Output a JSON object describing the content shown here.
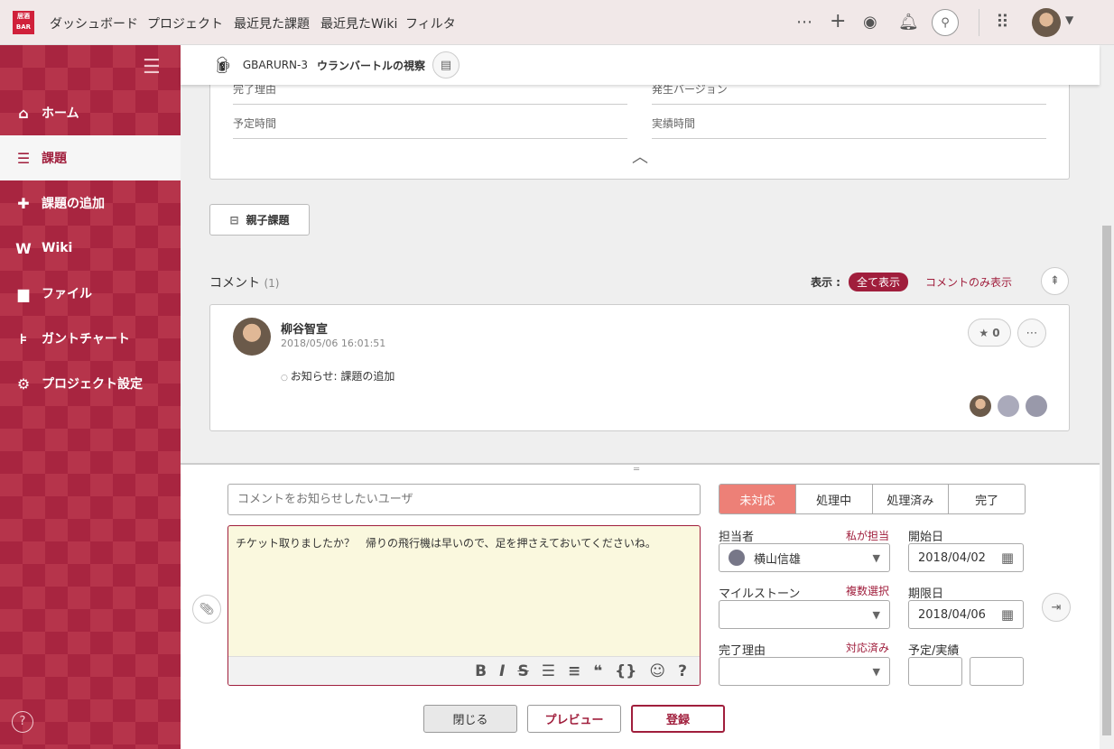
{
  "topbar": {
    "logo": "居酒BAR",
    "nav": [
      "ダッシュボード",
      "プロジェクト",
      "最近見た課題",
      "最近見たWiki",
      "フィルタ"
    ]
  },
  "sidebar": {
    "items": [
      {
        "icon": "home-icon",
        "label": "ホーム"
      },
      {
        "icon": "list-icon",
        "label": "課題"
      },
      {
        "icon": "plus-icon",
        "label": "課題の追加"
      },
      {
        "icon": "wiki-icon",
        "label": "Wiki"
      },
      {
        "icon": "folder-icon",
        "label": "ファイル"
      },
      {
        "icon": "gantt-icon",
        "label": "ガントチャート"
      },
      {
        "icon": "gear-icon",
        "label": "プロジェクト設定"
      }
    ],
    "active": 1
  },
  "issue": {
    "key": "GBARURN-3",
    "title": "ウランバートルの視察"
  },
  "details": {
    "cut_left": "完了理由",
    "cut_right": "発生バージョン",
    "left": "予定時間",
    "right": "実績時間"
  },
  "parent_button": "親子課題",
  "comments": {
    "title": "コメント",
    "count": "(1)",
    "display_label": "表示 :",
    "filter_all": "全て表示",
    "filter_comments": "コメントのみ表示",
    "items": [
      {
        "author": "柳谷智宣",
        "date": "2018/05/06 16:01:51",
        "change": "お知らせ: 課題の追加",
        "stars": "0"
      }
    ]
  },
  "form": {
    "notify_placeholder": "コメントをお知らせしたいユーザ",
    "comment": "チケット取りましたか？　帰りの飛行機は早いので、足を押さえておいてくださいね。",
    "statuses": [
      "未対応",
      "処理中",
      "処理済み",
      "完了"
    ],
    "active_status": 0,
    "assignee_label": "担当者",
    "assign_me": "私が担当",
    "assignee": "横山信雄",
    "start_label": "開始日",
    "start_date": "2018/04/02",
    "milestone_label": "マイルストーン",
    "multi_select": "複数選択",
    "milestone": "",
    "due_label": "期限日",
    "due_date": "2018/04/06",
    "resolution_label": "完了理由",
    "resolved": "対応済み",
    "resolution": "",
    "hours_label": "予定/実績",
    "estimated": "",
    "actual": "",
    "toolbar": [
      "B",
      "I",
      "S",
      "☰",
      "≡",
      "❝",
      "{}",
      "☺",
      "?"
    ],
    "close": "閉じる",
    "preview": "プレビュー",
    "submit": "登録"
  },
  "colors": {
    "brand": "#a01e3c",
    "status_open": "#ed8077",
    "comment_bg": "#faf8de"
  }
}
